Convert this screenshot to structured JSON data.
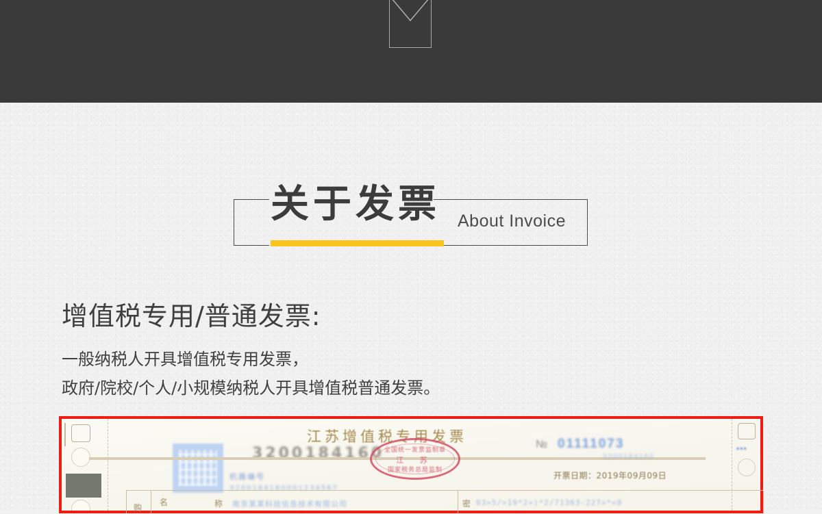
{
  "page": {
    "background_color": "#f1f1f1",
    "accent_color": "#fbc41d",
    "dark_bar_color": "#3a3a3a",
    "invoice_border_color": "#ee1c12"
  },
  "top_banner": {
    "tab_icon": "chevron-down-in-box"
  },
  "section_title": {
    "cn": "关于发票",
    "en": "About Invoice"
  },
  "content": {
    "heading": "增值税专用/普通发票:",
    "paragraph_lines": [
      "一般纳税人开具增值税专用发票，",
      "政府/院校/个人/小规模纳税人开具增值税普通发票。"
    ]
  },
  "invoice_photo": {
    "title": "江苏增值税专用发票",
    "number_symbol": "№",
    "serial": "01111073",
    "serial_sub": "3200184160",
    "machine_number": "3200184160",
    "qr_caption_1": "机器编号",
    "qr_caption_2": "3200184160001234567",
    "date_label": "开票日期：",
    "date_value": "2019年09月09日",
    "stamp": {
      "top_text": "全国统一发票监制章",
      "mid_text": "江 苏",
      "bottom_text": "国家税务总局监制"
    },
    "table": {
      "row_header": "购",
      "col_name_label": "名",
      "col_name_label2": "称",
      "col_name_value": "南京某某科技信息技术有限公司",
      "col_cipher_label": "密",
      "col_cipher_value": "03>5/>19*2+)*2/71363-227>*<0"
    },
    "left_strip": {
      "gray_block": "dark-gray-rectangle",
      "blue_mark": "blue-smudge"
    },
    "right_strip": {
      "blue_mark": "blue-smudge"
    }
  }
}
